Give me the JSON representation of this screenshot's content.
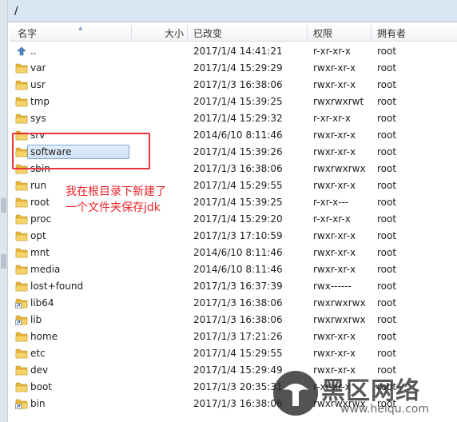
{
  "path": "/",
  "columns": {
    "name": "名字",
    "size": "大小",
    "modified": "已改变",
    "permissions": "权限",
    "owner": "拥有者"
  },
  "files": [
    {
      "name": "..",
      "icon": "parent-dir-icon",
      "modified": "2017/1/4 14:41:21",
      "permissions": "r-xr-xr-x",
      "owner": "root"
    },
    {
      "name": "var",
      "icon": "folder-icon",
      "modified": "2017/1/4 15:29:29",
      "permissions": "rwxr-xr-x",
      "owner": "root"
    },
    {
      "name": "usr",
      "icon": "folder-icon",
      "modified": "2017/1/3 16:38:06",
      "permissions": "rwxr-xr-x",
      "owner": "root"
    },
    {
      "name": "tmp",
      "icon": "folder-icon",
      "modified": "2017/1/4 15:39:25",
      "permissions": "rwxrwxrwt",
      "owner": "root"
    },
    {
      "name": "sys",
      "icon": "folder-icon",
      "modified": "2017/1/4 15:29:32",
      "permissions": "r-xr-xr-x",
      "owner": "root"
    },
    {
      "name": "srv",
      "icon": "folder-icon",
      "modified": "2014/6/10 8:11:46",
      "permissions": "rwxr-xr-x",
      "owner": "root"
    },
    {
      "name": "software",
      "icon": "folder-icon",
      "modified": "2017/1/4 15:39:26",
      "permissions": "rwxr-xr-x",
      "owner": "root",
      "selected": true
    },
    {
      "name": "sbin",
      "icon": "folder-icon",
      "modified": "2017/1/3 16:38:06",
      "permissions": "rwxrwxrwx",
      "owner": "root"
    },
    {
      "name": "run",
      "icon": "folder-icon",
      "modified": "2017/1/4 15:29:55",
      "permissions": "rwxr-xr-x",
      "owner": "root"
    },
    {
      "name": "root",
      "icon": "folder-icon",
      "modified": "2017/1/4 15:39:25",
      "permissions": "r-xr-x---",
      "owner": "root"
    },
    {
      "name": "proc",
      "icon": "folder-icon",
      "modified": "2017/1/4 15:29:20",
      "permissions": "r-xr-xr-x",
      "owner": "root"
    },
    {
      "name": "opt",
      "icon": "folder-icon",
      "modified": "2017/1/3 17:10:59",
      "permissions": "rwxr-xr-x",
      "owner": "root"
    },
    {
      "name": "mnt",
      "icon": "folder-icon",
      "modified": "2014/6/10 8:11:46",
      "permissions": "rwxr-xr-x",
      "owner": "root"
    },
    {
      "name": "media",
      "icon": "folder-icon",
      "modified": "2014/6/10 8:11:46",
      "permissions": "rwxr-xr-x",
      "owner": "root"
    },
    {
      "name": "lost+found",
      "icon": "folder-icon",
      "modified": "2017/1/3 16:37:39",
      "permissions": "rwx------",
      "owner": "root"
    },
    {
      "name": "lib64",
      "icon": "folder-link-icon",
      "modified": "2017/1/3 16:38:06",
      "permissions": "rwxrwxrwx",
      "owner": "root"
    },
    {
      "name": "lib",
      "icon": "folder-link-icon",
      "modified": "2017/1/3 16:38:06",
      "permissions": "rwxrwxrwx",
      "owner": "root"
    },
    {
      "name": "home",
      "icon": "folder-icon",
      "modified": "2017/1/3 17:21:26",
      "permissions": "rwxr-xr-x",
      "owner": "root"
    },
    {
      "name": "etc",
      "icon": "folder-icon",
      "modified": "2017/1/4 15:29:55",
      "permissions": "rwxr-xr-x",
      "owner": "root"
    },
    {
      "name": "dev",
      "icon": "folder-icon",
      "modified": "2017/1/4 15:29:49",
      "permissions": "rwxr-xr-x",
      "owner": "root"
    },
    {
      "name": "boot",
      "icon": "folder-icon",
      "modified": "2017/1/3 20:35:31",
      "permissions": "r-xr-xr-x",
      "owner": "root"
    },
    {
      "name": "bin",
      "icon": "folder-link-icon",
      "modified": "2017/1/3 16:38:06",
      "permissions": "rwxrwxrwx",
      "owner": "root"
    }
  ],
  "annotation": {
    "line1": "我在根目录下新建了",
    "line2": "一个文件夹保存jdk"
  },
  "watermark": {
    "text": "黑区网络",
    "url": "www.heiqu.com"
  },
  "colors": {
    "annotation_red": "#e8343a",
    "folder_yellow": "#f2c94c",
    "selection_blue": "#cfe2f8"
  }
}
